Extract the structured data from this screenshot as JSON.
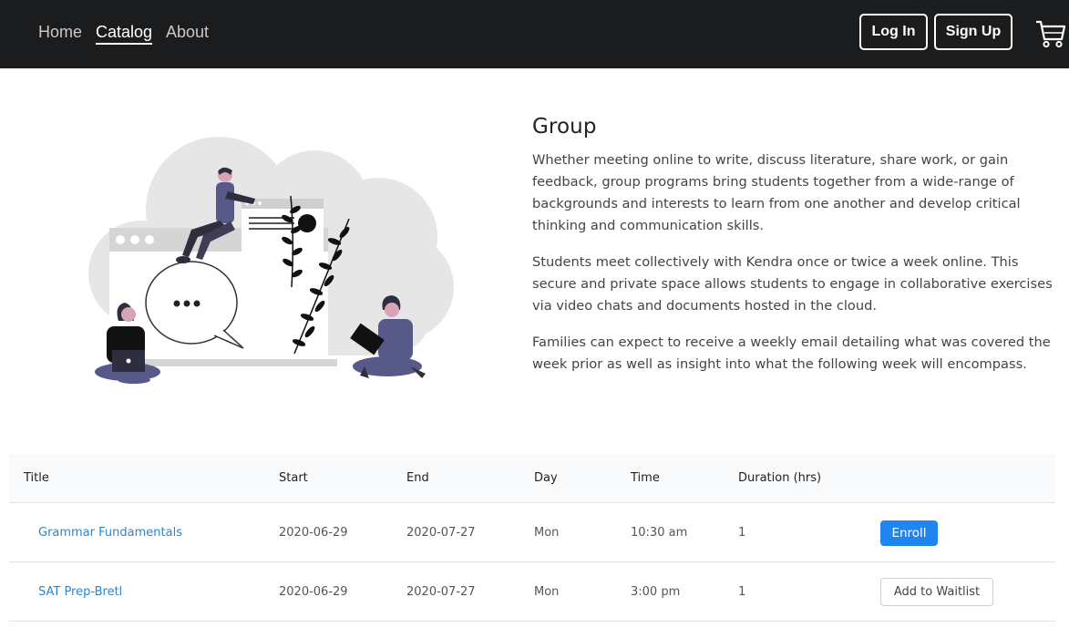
{
  "nav": {
    "links": [
      "Home",
      "Catalog",
      "About"
    ],
    "active": "Catalog",
    "login_label": "Log In",
    "signup_label": "Sign Up",
    "cart_icon": "shopping-cart-icon"
  },
  "hero": {
    "title": "Group",
    "paragraphs": [
      "Whether meeting online to write, discuss literature, share work, or gain feedback, group programs bring students together from a wide-range of backgrounds and interests to learn from one another and develop critical thinking and communication skills.",
      "Students meet collectively with Kendra once or twice a week online. This secure and private space allows students to engage in collaborative exercises via video chats and documents hosted in the cloud.",
      "Families can expect to receive a weekly email detailing what was covered the week prior as well as insight into what the following week will encompass."
    ]
  },
  "table": {
    "headers": [
      "Title",
      "Start",
      "End",
      "Day",
      "Time",
      "Duration (hrs)"
    ],
    "rows": [
      {
        "title": "Grammar Fundamentals",
        "start": "2020-06-29",
        "end": "2020-07-27",
        "day": "Mon",
        "time": "10:30 am",
        "duration": "1",
        "action": "Enroll"
      },
      {
        "title": "SAT Prep-Bretl",
        "start": "2020-06-29",
        "end": "2020-07-27",
        "day": "Mon",
        "time": "3:00 pm",
        "duration": "1",
        "action": "Add to Waitlist"
      }
    ]
  },
  "colors": {
    "navbar": "#1b1c1d",
    "link": "#2b86d1",
    "primary_button": "#2185f0",
    "accent_figure": "#d6a4b6"
  }
}
